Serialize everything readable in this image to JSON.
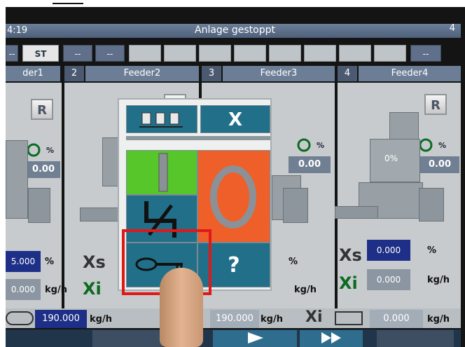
{
  "window": {
    "time": "4:19",
    "title": "Anlage gestoppt",
    "page_number": "4"
  },
  "status_row": {
    "box1": "--",
    "st": "ST",
    "box3": "--",
    "box4": "--",
    "last": "--"
  },
  "feeders": [
    {
      "num": "",
      "name": "der1"
    },
    {
      "num": "2",
      "name": "Feeder2"
    },
    {
      "num": "3",
      "name": "Feeder3"
    },
    {
      "num": "4",
      "name": "Feeder4"
    }
  ],
  "feeder_values": {
    "f1_pct_value": "0.00",
    "f3_pct_value": "0.00",
    "f4_pct_value": "0.00",
    "f4_level": "0%",
    "pct_label": "%",
    "reset_label": "R"
  },
  "setpoints": {
    "xs_label": "Xs",
    "xi_label": "Xi",
    "f1_xs": "5.000",
    "f1_xi": "0.000",
    "f3_xs_unit": "%",
    "f3_xi_unit": "kg/h",
    "f4_xs": "0.000",
    "f4_xi": "0.000",
    "pct_unit": "%",
    "kgh_unit": "kg/h"
  },
  "totals": {
    "total1": "190.000",
    "total1_unit": "kg/h",
    "total2": "190.000",
    "total2_unit": "kg/h",
    "total3": "0.000",
    "total3_unit": "kg/h"
  },
  "popup": {
    "close_label": "X",
    "help_label": "?"
  }
}
